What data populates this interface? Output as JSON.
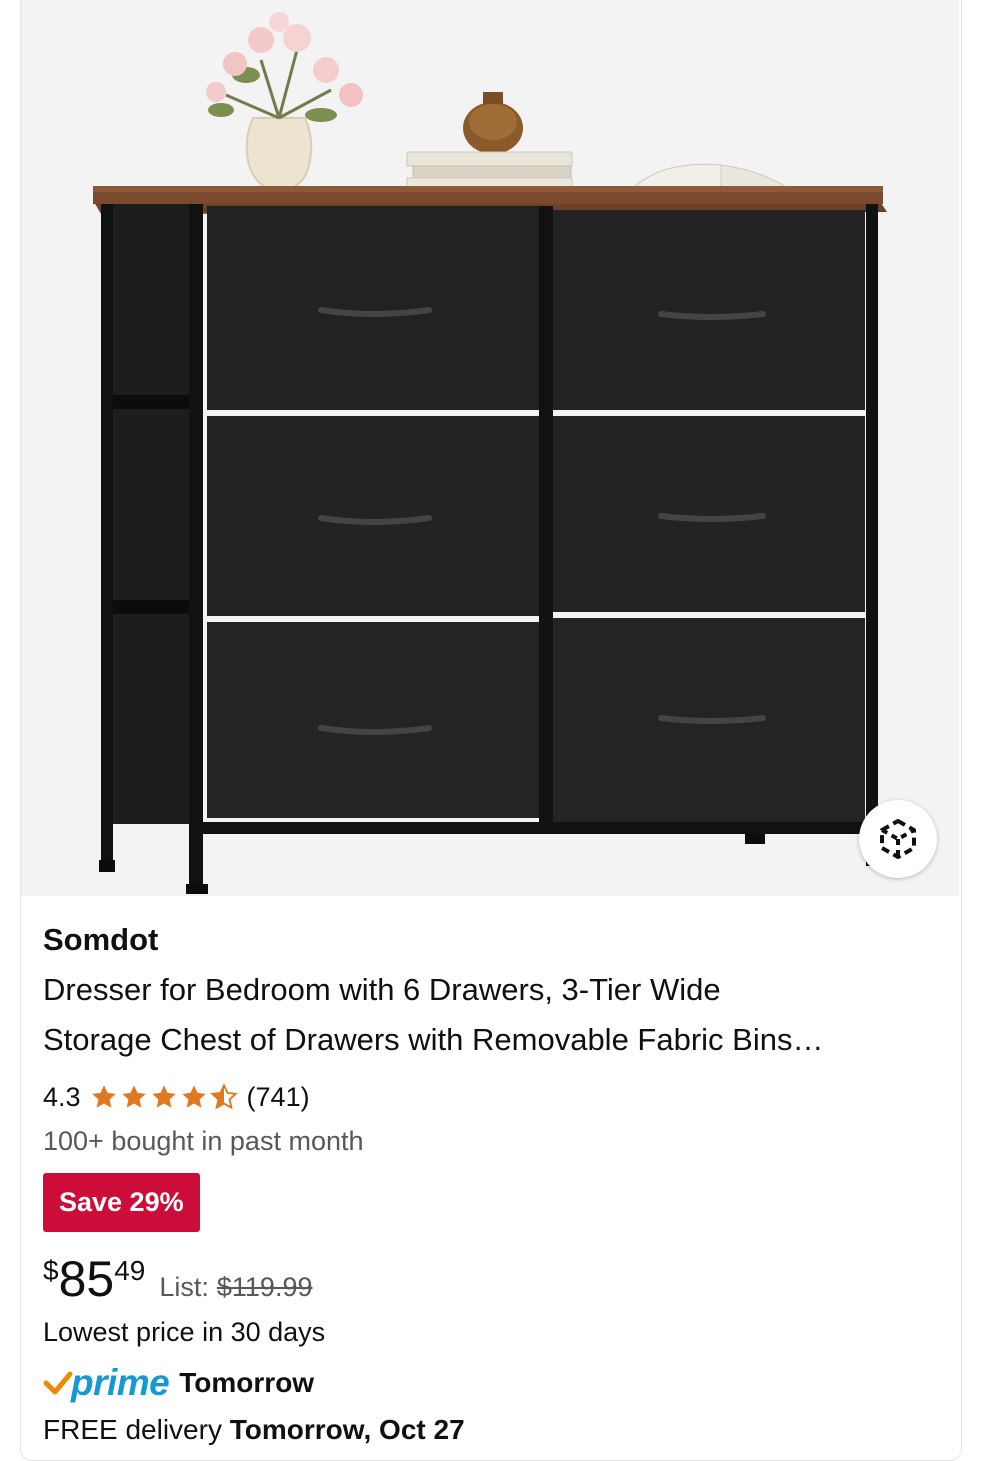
{
  "product": {
    "brand": "Somdot",
    "title_line1": "Dresser for Bedroom with 6 Drawers, 3-Tier Wide",
    "title_line2": "Storage Chest of Drawers with Removable Fabric Bins…",
    "rating": "4.3",
    "rating_value": 4.3,
    "review_count": "(741)",
    "bought": "100+ bought in past month",
    "save_badge": "Save 29%",
    "price": {
      "symbol": "$",
      "whole": "85",
      "fraction": "49"
    },
    "list_label": "List:",
    "list_price": "$119.99",
    "lowest_price": "Lowest price in 30 days",
    "prime": {
      "logo": "prime",
      "delivery": "Tomorrow"
    },
    "delivery": {
      "prefix": "FREE delivery",
      "date": "Tomorrow, Oct 27"
    },
    "image_icon": "dresser-product-photo",
    "view_3d_icon": "3d-cube-icon"
  },
  "colors": {
    "save_badge": "#cc0c39",
    "star": "#de7921",
    "prime_blue": "#1399d3",
    "prime_check": "#f08804",
    "secondary_text": "#565959"
  }
}
